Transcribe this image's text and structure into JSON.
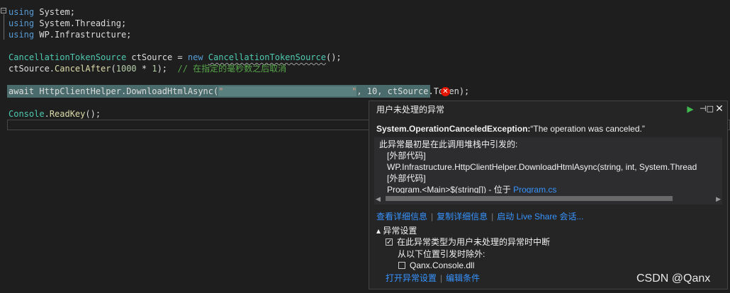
{
  "code": {
    "line1": {
      "kw": "using",
      "ns": "System;"
    },
    "line2": {
      "kw": "using",
      "ns": "System.Threading;"
    },
    "line3": {
      "kw": "using",
      "ns": "WP.Infrastructure;"
    },
    "line5": {
      "type1": "CancellationTokenSource",
      "var": " ctSource = ",
      "kw": "new",
      "sp": " ",
      "type2": "CancellationTokenSource",
      "end": "();"
    },
    "line6": {
      "obj": "ctSource.",
      "method": "CancelAfter",
      "open": "(",
      "num1": "1000",
      "op": " * ",
      "num2": "1",
      "close": ");  ",
      "comment": "// 在指定的毫秒数之后取消"
    },
    "line8": {
      "await": "await ",
      "cls": "HttpClientHelper",
      "dot": ".",
      "method": "DownloadHtmlAsync",
      "open": "(",
      "str": "\"                         \"",
      "rest": ", 10, ctSource.Token);"
    },
    "line10": {
      "cls": "Console",
      "dot": ".",
      "method": "ReadKey",
      "end": "();"
    }
  },
  "popup": {
    "title": "用户未处理的异常",
    "exception_type": "System.OperationCanceledException:",
    "exception_message": "“The operation was canceled.”",
    "trace_header": "此异常最初是在此调用堆栈中引发的:",
    "trace": [
      "[外部代码]",
      "WP.Infrastructure.HttpClientHelper.DownloadHtmlAsync(string, int, System.Thread",
      "[外部代码]"
    ],
    "trace_main_prefix": "Program.<Main>$(string[]) - 位于 ",
    "trace_main_link": "Program.cs",
    "actions": [
      "查看详细信息",
      "复制详细信息",
      "启动 Live Share 会话..."
    ],
    "settings_header": "▴ 异常设置",
    "break_option": "在此异常类型为用户未处理的异常时中断",
    "break_option_checked": true,
    "except_label": "从以下位置引发时除外:",
    "module_option": "Qanx.Console.dll",
    "module_option_checked": false,
    "footer_actions": [
      "打开异常设置",
      "编辑条件"
    ]
  },
  "watermark": "CSDN @Qanx"
}
